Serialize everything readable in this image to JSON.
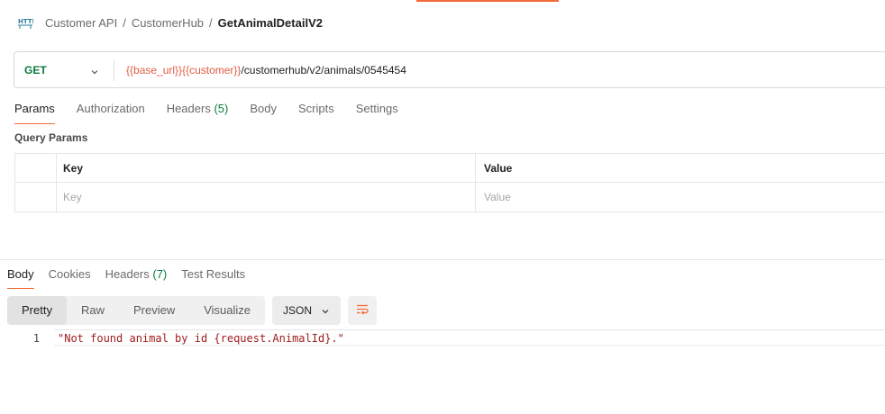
{
  "breadcrumb": {
    "items": [
      "Customer API",
      "CustomerHub"
    ],
    "current": "GetAnimalDetailV2",
    "separator": "/"
  },
  "request": {
    "method": "GET",
    "url_vars": [
      "{{base_url}}",
      "{{customer}}"
    ],
    "url_path": "/customerhub/v2/animals/0545454"
  },
  "request_tabs": [
    {
      "label": "Params",
      "count": ""
    },
    {
      "label": "Authorization",
      "count": ""
    },
    {
      "label": "Headers",
      "count": "(5)"
    },
    {
      "label": "Body",
      "count": ""
    },
    {
      "label": "Scripts",
      "count": ""
    },
    {
      "label": "Settings",
      "count": ""
    }
  ],
  "query_params": {
    "title": "Query Params",
    "headers": {
      "key": "Key",
      "value": "Value"
    },
    "placeholder": {
      "key": "Key",
      "value": "Value"
    }
  },
  "response_tabs": [
    {
      "label": "Body",
      "count": ""
    },
    {
      "label": "Cookies",
      "count": ""
    },
    {
      "label": "Headers",
      "count": "(7)"
    },
    {
      "label": "Test Results",
      "count": ""
    }
  ],
  "view_modes": [
    "Pretty",
    "Raw",
    "Preview",
    "Visualize"
  ],
  "format": "JSON",
  "response_body": {
    "line_number": "1",
    "text": "\"Not found animal by id {request.AnimalId}.\""
  },
  "colors": {
    "accent": "#f26b3a",
    "method_get": "#0b7a3b",
    "url_variable": "#e05d44",
    "string_value": "#9e1a1a"
  },
  "icons": {
    "http": "http-request-icon",
    "chevron": "chevron-down-icon",
    "wrap": "wrap-lines-icon"
  }
}
